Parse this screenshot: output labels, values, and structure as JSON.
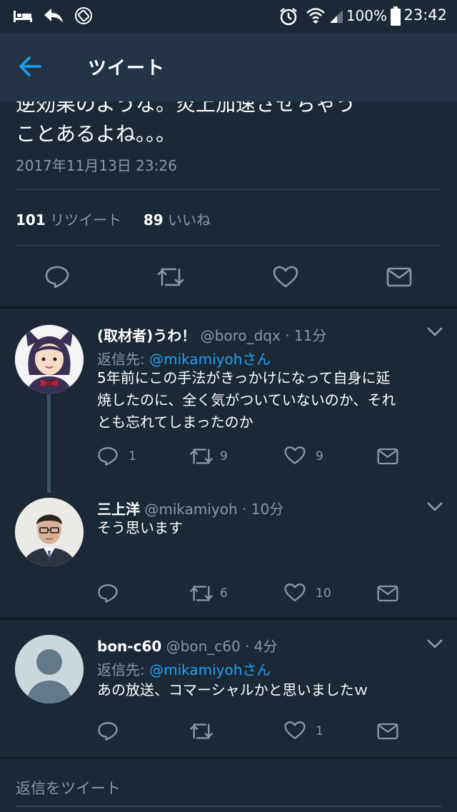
{
  "status_bar": {
    "battery": "100%",
    "time": "23:42",
    "icons": [
      "hotel-icon",
      "reply-arrow-icon",
      "rotate-icon",
      "alarm-icon",
      "wifi-icon",
      "signal-icon",
      "battery-icon"
    ]
  },
  "header": {
    "title": "ツイート",
    "back_icon": "arrow-left-icon"
  },
  "focused_tweet": {
    "text_line1": "逆効果のような。炎上加速させちゃう",
    "text_line2": "ことあるよね。。。",
    "date": "2017年11月13日 23:26",
    "retweet_count": "101",
    "retweet_label": "リツイート",
    "like_count": "89",
    "like_label": "いいね"
  },
  "replies": [
    {
      "name": "(取材者)うわ！",
      "handle": "@boro_dqx",
      "time": "· 11分",
      "reply_to_label": "返信先:",
      "reply_to": "@mikamiyohさん",
      "text_lines": [
        "5年前にこの手法がきっかけになって自身に延",
        "焼したのに、全く気がついていないのか、それ",
        "とも忘れてしまったのか"
      ],
      "reply_count": "1",
      "retweet_count": "9",
      "like_count": "9"
    },
    {
      "name": "三上洋",
      "handle": "@mikamiyoh",
      "time": "· 10分",
      "text_lines": [
        "そう思います"
      ],
      "reply_count": "",
      "retweet_count": "6",
      "like_count": "10"
    },
    {
      "name": "bon-c60",
      "handle": "@bon_c60",
      "time": "· 4分",
      "reply_to_label": "返信先:",
      "reply_to": "@mikamiyohさん",
      "text_lines": [
        "あの放送、コマーシャルかと思いましたｗ"
      ],
      "reply_count": "",
      "retweet_count": "",
      "like_count": "1"
    }
  ],
  "reply_box": {
    "placeholder": "返信をツイート"
  },
  "colors": {
    "background": "#1b2836",
    "header": "#243447",
    "accent": "#1da1f2",
    "secondary_text": "#8899a6"
  }
}
